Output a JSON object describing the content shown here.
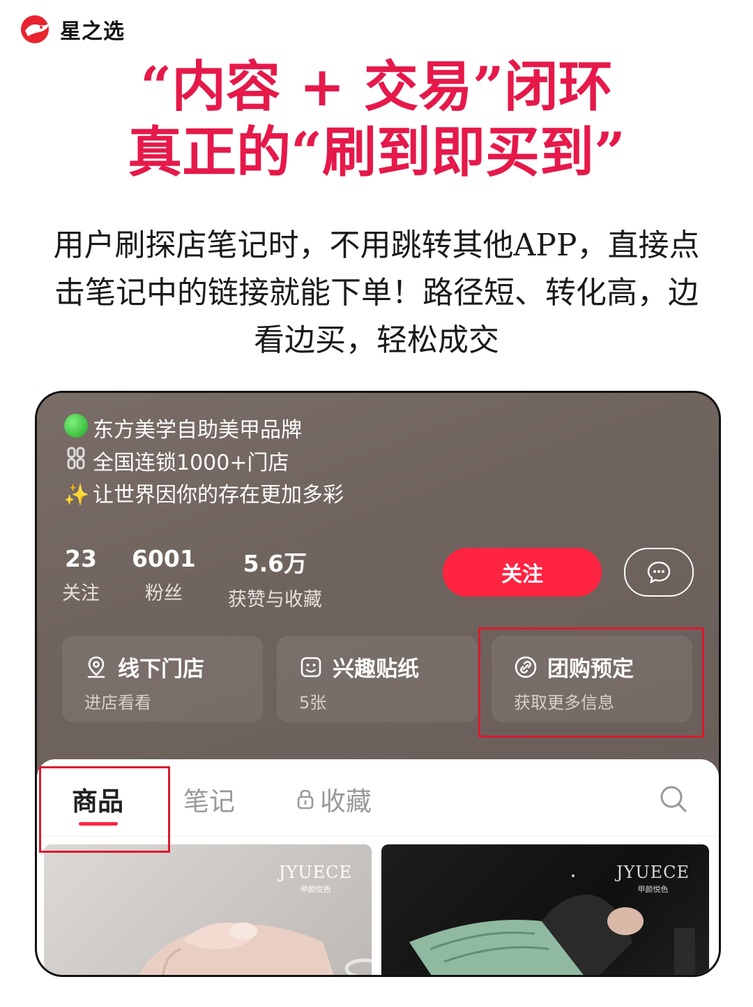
{
  "brand": {
    "name": "星之选",
    "logo_icon": "red-bird-logo"
  },
  "headline": {
    "line1": "“内容 + 交易”闭环",
    "line2": "真正的“刷到即买到”"
  },
  "description": "用户刷探店笔记时，不用跳转其他APP，直接点击笔记中的链接就能下单！路径短、转化高，边看边买，轻松成交",
  "colors": {
    "accent": "#e5194a",
    "follow": "#ff2442",
    "highlight_box": "#d91a2f",
    "profile_bg": "#6e625d"
  },
  "profile": {
    "bio": [
      {
        "emoji": "🟢",
        "icon": "green-circle-icon",
        "text": "东方美学自助美甲品牌"
      },
      {
        "emoji": "⛓",
        "icon": "chain-icon",
        "text": " 全国连锁1000+门店"
      },
      {
        "emoji": "✨",
        "icon": "sparkles-icon",
        "text": "让世界因你的存在更加多彩"
      }
    ],
    "stats": [
      {
        "value": "23",
        "label": "关注"
      },
      {
        "value": "6001",
        "label": "粉丝"
      },
      {
        "value": "5.6万",
        "label": "获赞与收藏"
      }
    ],
    "follow_label": "关注",
    "message_icon": "chat-bubble-icon",
    "cards": [
      {
        "icon": "location-pin-icon",
        "title": "线下门店",
        "subtitle": "进店看看"
      },
      {
        "icon": "sticker-face-icon",
        "title": "兴趣贴纸",
        "subtitle": "5张"
      },
      {
        "icon": "link-icon",
        "title": "团购预定",
        "subtitle": "获取更多信息"
      }
    ]
  },
  "tabs": {
    "products": "商品",
    "notes": "笔记",
    "favorites": "收藏",
    "favorites_icon": "lock-icon",
    "search_icon": "search-icon"
  },
  "products": [
    {
      "brand": "JYUECE",
      "brand_sub": "甲颜悦色"
    },
    {
      "brand": "JYUECE",
      "brand_sub": "甲颜悦色"
    }
  ]
}
